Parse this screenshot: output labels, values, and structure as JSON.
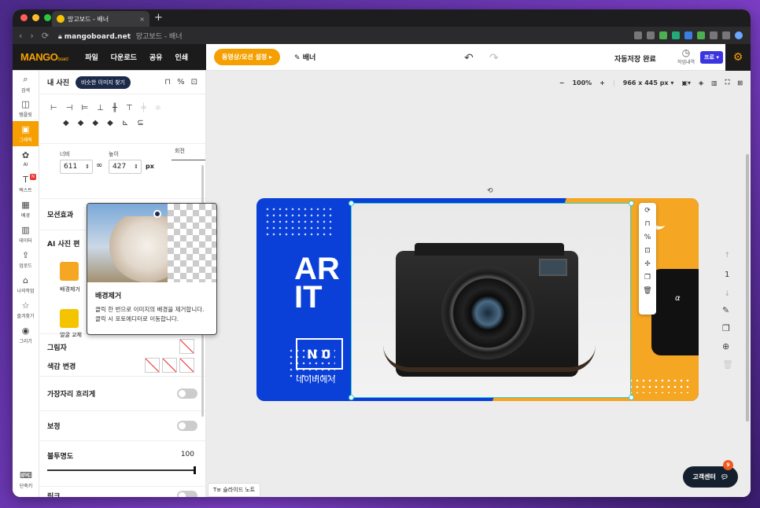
{
  "browser": {
    "tab_title": "망고보드 - 배너",
    "new_tab": "+",
    "url_host": "mangoboard.net",
    "url_title": "망고보드 - 배너",
    "dot_colors": [
      "#ff5f57",
      "#febc2e",
      "#28c840"
    ]
  },
  "header": {
    "logo": "MANGO",
    "logo_sub": "board",
    "menu": [
      "파일",
      "다운로드",
      "공유",
      "인쇄"
    ],
    "promo_button": "동영상/모션 설정 ▸",
    "doc_name": "배너",
    "undo": "↶",
    "redo": "↷",
    "save_status": "자동저장 완료",
    "history": "작업내역",
    "pro_badge": "프로 ▾"
  },
  "rail": [
    {
      "icon": "⌕",
      "label": "검색"
    },
    {
      "icon": "◫",
      "label": "템플릿"
    },
    {
      "icon": "▣",
      "label": "그래픽"
    },
    {
      "icon": "✿",
      "label": "AI"
    },
    {
      "icon": "T",
      "label": "텍스트",
      "badge": "N"
    },
    {
      "icon": "▦",
      "label": "배경"
    },
    {
      "icon": "▥",
      "label": "데이터"
    },
    {
      "icon": "⇪",
      "label": "업로드"
    },
    {
      "icon": "⌂",
      "label": "나의작업"
    },
    {
      "icon": "☆",
      "label": "즐겨찾기"
    },
    {
      "icon": "◉",
      "label": "그리기"
    }
  ],
  "rail_bottom": {
    "icon": "⌨",
    "label": "단축키"
  },
  "panel": {
    "title": "내 사진",
    "similar_button": "비슷한 이미지 찾기",
    "align_row1": [
      "⊢",
      "⊣",
      "⊨",
      "⊥",
      "╫",
      "⊤",
      "╪",
      "≑"
    ],
    "align_row2": [
      "◆",
      "◆",
      "◆",
      "◆",
      "⊾",
      "⊆"
    ],
    "width_label": "너비",
    "width_value": "611",
    "height_label": "높이",
    "height_value": "427",
    "unit": "px",
    "rotate_label": "회전",
    "motion_label": "모션효과",
    "ai_label": "AI 사진 편",
    "bg_remove": "배경제거",
    "face_swap": "얼굴 교체",
    "shadow": "그림자",
    "color_change": "색감 변경",
    "edge_blur": "가장자리 흐리게",
    "correction": "보정",
    "opacity": "불투명도",
    "opacity_value": "100",
    "link": "링크"
  },
  "tooltip": {
    "title": "배경제거",
    "desc1": "클릭 한 번으로 이미지의 배경을 제거합니다.",
    "desc2": "클릭 시 포토에디터로 이동합니다."
  },
  "canvas": {
    "zoom_minus": "−",
    "zoom": "100%",
    "zoom_plus": "+",
    "size": "966 x 445 px ▾",
    "design_text": "AR\nIT",
    "design_n": "N 0",
    "design_naver": "네이버에서",
    "alpha": "α",
    "page_num": "1",
    "slide_note": "슬라이드 노트",
    "help": "고객센터",
    "help_count": "9",
    "colors": {
      "blue": "#0a3fd8",
      "orange": "#f5a623",
      "accent": "#f5a000",
      "selection": "#33cccc"
    }
  }
}
